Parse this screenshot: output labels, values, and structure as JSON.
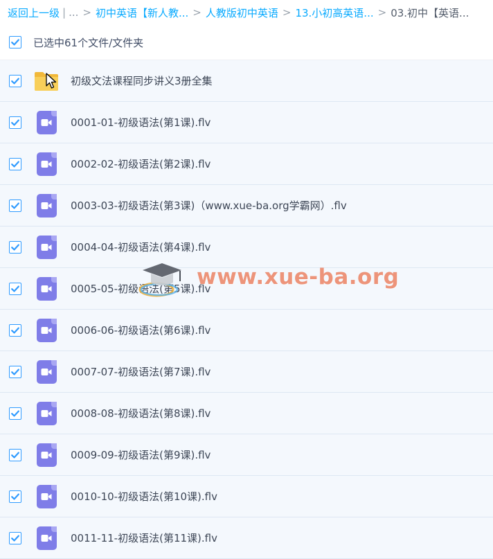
{
  "breadcrumb": {
    "items": [
      {
        "label": "返回上一级",
        "link": true
      },
      {
        "label": "...",
        "link": true
      },
      {
        "label": "初中英语【新人教...",
        "link": true
      },
      {
        "label": "人教版初中英语",
        "link": true
      },
      {
        "label": "13.小初高英语...",
        "link": true
      },
      {
        "label": "03.初中【英语...",
        "link": false
      }
    ],
    "pipe": "|",
    "separator": ">"
  },
  "selection": {
    "label": "已选中61个文件/文件夹",
    "checked": true
  },
  "files": [
    {
      "name": "初级文法课程同步讲义3册全集",
      "type": "folder",
      "checked": true
    },
    {
      "name": "0001-01-初级语法(第1课).flv",
      "type": "video",
      "checked": true
    },
    {
      "name": "0002-02-初级语法(第2课).flv",
      "type": "video",
      "checked": true
    },
    {
      "name": "0003-03-初级语法(第3课)（www.xue-ba.org学霸网）.flv",
      "type": "video",
      "checked": true
    },
    {
      "name": "0004-04-初级语法(第4课).flv",
      "type": "video",
      "checked": true
    },
    {
      "name": "0005-05-初级语法(第5课).flv",
      "type": "video",
      "checked": true
    },
    {
      "name": "0006-06-初级语法(第6课).flv",
      "type": "video",
      "checked": true
    },
    {
      "name": "0007-07-初级语法(第7课).flv",
      "type": "video",
      "checked": true
    },
    {
      "name": "0008-08-初级语法(第8课).flv",
      "type": "video",
      "checked": true
    },
    {
      "name": "0009-09-初级语法(第9课).flv",
      "type": "video",
      "checked": true
    },
    {
      "name": "0010-10-初级语法(第10课).flv",
      "type": "video",
      "checked": true
    },
    {
      "name": "0011-11-初级语法(第11课).flv",
      "type": "video",
      "checked": true
    }
  ],
  "watermark": {
    "text": "www.xue-ba.org"
  },
  "colors": {
    "link": "#09aaff",
    "checkbox": "#2f9bff",
    "video_icon": "#7f7de8",
    "folder": "#f6c64a",
    "row_bg": "#f4f8fd"
  }
}
